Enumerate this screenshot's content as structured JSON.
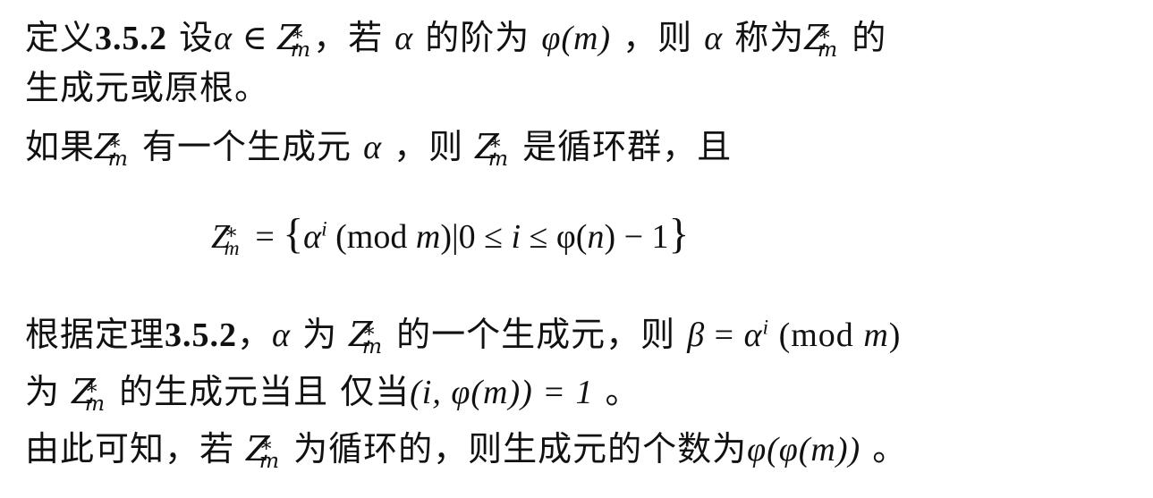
{
  "lines": {
    "l1": {
      "def_label": "定义",
      "def_num": "3.5.2",
      "t1": " 设",
      "t2": "，若 ",
      "t3": " 的阶为 ",
      "t4": " ，则 ",
      "t5": " 称为",
      "t6": " 的"
    },
    "l2": {
      "t1": "生成元或原根。"
    },
    "l3": {
      "t1": "如果",
      "t2": " 有一个生成元 ",
      "t3": " ，则 ",
      "t4": " 是循环群，且"
    },
    "l5": {
      "t1": "根据定理",
      "thm": "3.5.2",
      "t2": "，",
      "t3": " 为 ",
      "t4": " 的一个生成元，则 "
    },
    "l6": {
      "t1": "为 ",
      "t2": " 的生成元当且 仅当",
      "t3": " 。"
    },
    "l7": {
      "t1": "由此可知，若 ",
      "t2": " 为循环的，则生成元的个数为",
      "t3": " 。"
    }
  },
  "math": {
    "alpha": "α",
    "beta": "β",
    "in": " ∈ ",
    "Z": "Z",
    "star": "∗",
    "m": "m",
    "phi_m": "φ(m)",
    "formula_eq": " = ",
    "formula_body_1": "α",
    "formula_i": "i",
    "formula_body_2": " (mod ",
    "formula_body_3": ")|0 ≤ ",
    "formula_body_4": " ≤ φ(",
    "formula_n": "n",
    "formula_body_5": ") − 1",
    "lbrace": "{",
    "rbrace": "}",
    "beta_expr_1": " = ",
    "beta_expr_2": " (mod ",
    "beta_expr_3": ")",
    "gcd_expr": "(i, φ(m)) = 1",
    "phiphi": "φ(φ(m))"
  }
}
